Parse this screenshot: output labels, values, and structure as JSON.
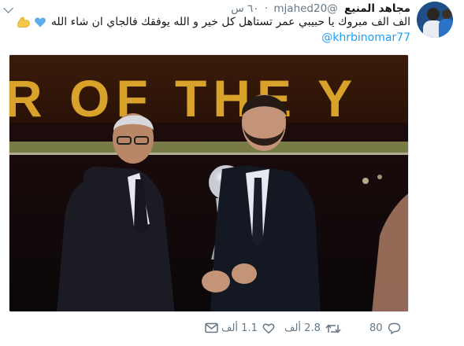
{
  "tweet": {
    "author_name": "مجاهد المنيع",
    "handle": "@mjahed20",
    "timestamp": "٦٠ س",
    "text": "الف الف مبروك يا حبيبي عمر تستاهل كل خير و الله يوفقك فالجاي ان شاء الله",
    "mention": "@khrbinomar77",
    "emojis": [
      "blue-heart-icon",
      "flexed-biceps-icon"
    ]
  },
  "photo": {
    "banner_text": "R OF THE Y"
  },
  "actions": {
    "reply_count": "80",
    "retweet_count": "2.8 ألف",
    "like_count": "1.1 ألف"
  },
  "colors": {
    "link": "#1da1f2",
    "secondary_text": "#657786",
    "banner_gold": "#d9a22a",
    "heart_blue": "#5dadec"
  }
}
